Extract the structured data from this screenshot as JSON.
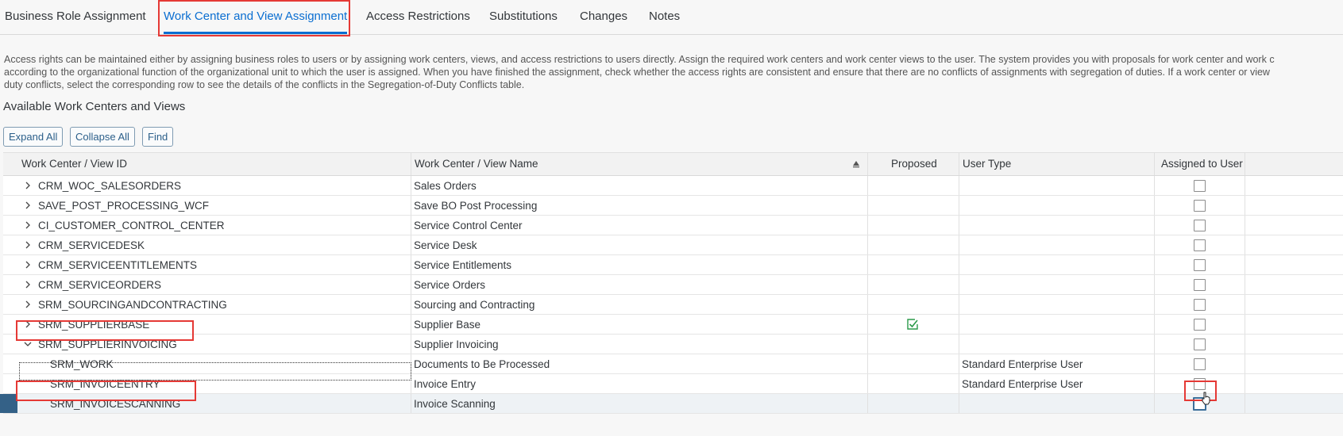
{
  "tabs": [
    {
      "label": "Business Role Assignment"
    },
    {
      "label": "Work Center and View Assignment"
    },
    {
      "label": "Access Restrictions"
    },
    {
      "label": "Substitutions"
    },
    {
      "label": "Changes"
    },
    {
      "label": "Notes"
    }
  ],
  "description": {
    "line1": "Access rights can be maintained either by assigning business roles to users or by assigning work centers, views, and access restrictions to users directly. Assign the required work centers and work center views to the user. The system provides you with proposals for work center and work c",
    "line2": "according to the organizational function of the organizational unit to which the user is assigned. When you have finished the assignment, check whether the access rights are consistent and ensure that there are no conflicts of assignments with segregation of duties. If a work center or view",
    "line3": "duty conflicts, select the corresponding row to see the details of the conflicts in the Segregation-of-Duty Conflicts table."
  },
  "section_title": "Available Work Centers and Views",
  "toolbar": {
    "expand_all": "Expand All",
    "collapse_all": "Collapse All",
    "find": "Find"
  },
  "table": {
    "columns": {
      "id": "Work Center / View ID",
      "name": "Work Center / View Name",
      "proposed": "Proposed",
      "user_type": "User Type",
      "assigned": "Assigned to User"
    },
    "rows": [
      {
        "id": "CRM_WOC_SALESORDERS",
        "name": "Sales Orders",
        "user_type": "",
        "expander": "collapsed",
        "proposed": false,
        "assigned": false
      },
      {
        "id": "SAVE_POST_PROCESSING_WCF",
        "name": "Save BO Post Processing",
        "user_type": "",
        "expander": "collapsed",
        "proposed": false,
        "assigned": false
      },
      {
        "id": "CI_CUSTOMER_CONTROL_CENTER",
        "name": "Service Control Center",
        "user_type": "",
        "expander": "collapsed",
        "proposed": false,
        "assigned": false
      },
      {
        "id": "CRM_SERVICEDESK",
        "name": "Service Desk",
        "user_type": "",
        "expander": "collapsed",
        "proposed": false,
        "assigned": false
      },
      {
        "id": "CRM_SERVICEENTITLEMENTS",
        "name": "Service Entitlements",
        "user_type": "",
        "expander": "collapsed",
        "proposed": false,
        "assigned": false
      },
      {
        "id": "CRM_SERVICEORDERS",
        "name": "Service Orders",
        "user_type": "",
        "expander": "collapsed",
        "proposed": false,
        "assigned": false
      },
      {
        "id": "SRM_SOURCINGANDCONTRACTING",
        "name": "Sourcing and Contracting",
        "user_type": "",
        "expander": "collapsed",
        "proposed": false,
        "assigned": false
      },
      {
        "id": "SRM_SUPPLIERBASE",
        "name": "Supplier Base",
        "user_type": "",
        "expander": "collapsed",
        "proposed": true,
        "assigned": false
      },
      {
        "id": "SRM_SUPPLIERINVOICING",
        "name": "Supplier Invoicing",
        "user_type": "",
        "expander": "expanded",
        "proposed": false,
        "assigned": false
      },
      {
        "id": "SRM_WORK",
        "name": "Documents to Be Processed",
        "user_type": "Standard Enterprise User",
        "expander": "none",
        "proposed": false,
        "assigned": false
      },
      {
        "id": "SRM_INVOICEENTRY",
        "name": "Invoice Entry",
        "user_type": "Standard Enterprise User",
        "expander": "none",
        "proposed": false,
        "assigned": false
      },
      {
        "id": "SRM_INVOICESCANNING",
        "name": "Invoice Scanning",
        "user_type": "",
        "expander": "none",
        "proposed": false,
        "assigned": false
      }
    ]
  },
  "colors": {
    "accent": "#0a6ed1",
    "highlight": "#e53935",
    "selected_marker": "#346187",
    "proposed_check": "#2b9a4a"
  },
  "icons": [
    "chevron-right-icon",
    "chevron-down-icon",
    "sort-ascending-icon",
    "proposed-check-icon",
    "mouse-cursor-icon"
  ]
}
